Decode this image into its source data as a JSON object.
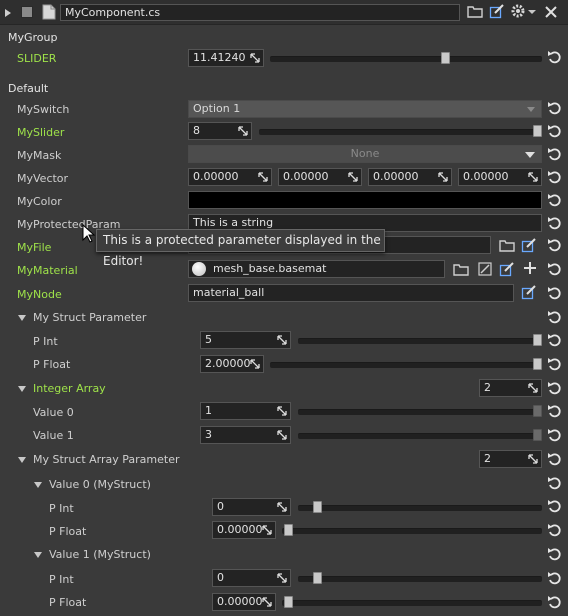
{
  "header": {
    "component_name": "MyComponent.cs"
  },
  "groups": {
    "mygroup": "MyGroup",
    "default": "Default"
  },
  "slider_param": {
    "label": "SLIDER",
    "value": "11.41240",
    "fraction": 0.65
  },
  "my_switch": {
    "label": "MySwitch",
    "value": "Option 1"
  },
  "my_slider": {
    "label": "MySlider",
    "value": "8",
    "fraction": 1.0
  },
  "my_mask": {
    "label": "MyMask",
    "value": "None"
  },
  "my_vector": {
    "label": "MyVector",
    "values": [
      "0.00000",
      "0.00000",
      "0.00000",
      "0.00000"
    ]
  },
  "my_color": {
    "label": "MyColor",
    "color": "#000000"
  },
  "my_protected": {
    "label": "MyProtectedParam",
    "value": "This is a string"
  },
  "tooltip": "This is a protected parameter displayed in the Editor!",
  "my_file": {
    "label": "MyFile"
  },
  "my_material": {
    "label": "MyMaterial",
    "value": "mesh_base.basemat"
  },
  "my_node": {
    "label": "MyNode",
    "value": "material_ball"
  },
  "struct_param": {
    "label": "My Struct Parameter",
    "p_int": {
      "label": "P Int",
      "value": "5",
      "fraction": 1.0
    },
    "p_float": {
      "label": "P Float",
      "value": "2.00000",
      "fraction": 1.0
    }
  },
  "integer_array": {
    "label": "Integer Array",
    "count": "2",
    "items": [
      {
        "label": "Value 0",
        "value": "1",
        "fraction": 1.0
      },
      {
        "label": "Value 1",
        "value": "3",
        "fraction": 1.0
      }
    ]
  },
  "struct_array": {
    "label": "My Struct Array Parameter",
    "count": "2",
    "items": [
      {
        "label": "Value 0 (MyStruct)",
        "p_int_label": "P Int",
        "p_int": "0",
        "p_float_label": "P Float",
        "p_float": "0.00000"
      },
      {
        "label": "Value 1 (MyStruct)",
        "p_int_label": "P Int",
        "p_int": "0",
        "p_float_label": "P Float",
        "p_float": "0.00000"
      }
    ]
  },
  "colors": {
    "accent_green": "#9fe34a",
    "background": "#3a3a3a",
    "field": "#232323"
  }
}
